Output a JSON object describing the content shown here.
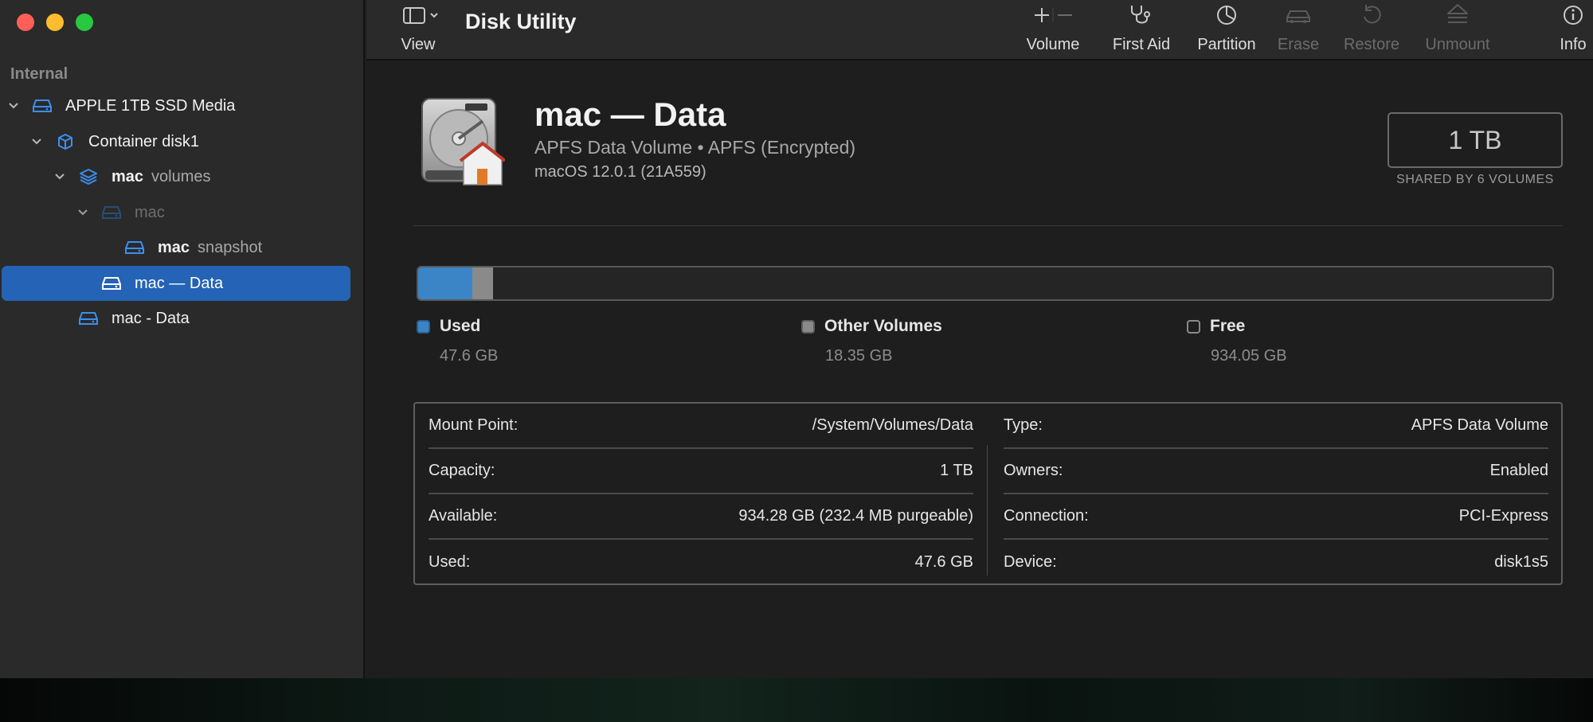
{
  "window": {
    "title": "Disk Utility"
  },
  "sidebar": {
    "section": "Internal",
    "items": [
      {
        "bold": "APPLE 1TB SSD Media",
        "light": ""
      },
      {
        "bold": "Container disk1",
        "light": ""
      },
      {
        "bold": "mac",
        "light": "volumes"
      },
      {
        "bold": "",
        "light": "mac"
      },
      {
        "bold": "mac",
        "light": "snapshot"
      },
      {
        "bold": "mac — Data",
        "light": ""
      },
      {
        "bold": "mac - Data",
        "light": ""
      }
    ]
  },
  "toolbar": {
    "view": "View",
    "volume": "Volume",
    "first_aid": "First Aid",
    "partition": "Partition",
    "erase": "Erase",
    "restore": "Restore",
    "unmount": "Unmount",
    "info": "Info"
  },
  "volume": {
    "name": "mac — Data",
    "subtitle": "APFS Data Volume • APFS (Encrypted)",
    "os": "macOS 12.0.1 (21A559)",
    "capacity": "1 TB",
    "shared": "SHARED BY 6 VOLUMES"
  },
  "usage": {
    "used_fraction": 0.0476,
    "other_fraction": 0.01835,
    "legend": [
      {
        "label": "Used",
        "value": "47.6 GB",
        "color": "#3b84c6"
      },
      {
        "label": "Other Volumes",
        "value": "18.35 GB",
        "color": "#8a8a8a"
      },
      {
        "label": "Free",
        "value": "934.05 GB",
        "color": "#1e1e1e"
      }
    ]
  },
  "info": {
    "left": [
      {
        "label": "Mount Point:",
        "value": "/System/Volumes/Data"
      },
      {
        "label": "Capacity:",
        "value": "1 TB"
      },
      {
        "label": "Available:",
        "value": "934.28 GB (232.4 MB purgeable)"
      },
      {
        "label": "Used:",
        "value": "47.6 GB"
      }
    ],
    "right": [
      {
        "label": "Type:",
        "value": "APFS Data Volume"
      },
      {
        "label": "Owners:",
        "value": "Enabled"
      },
      {
        "label": "Connection:",
        "value": "PCI-Express"
      },
      {
        "label": "Device:",
        "value": "disk1s5"
      }
    ]
  },
  "colors": {
    "accent": "#2463b5",
    "sidebar_icon": "#3b8ff0",
    "used": "#3b84c6",
    "other": "#8a8a8a"
  }
}
